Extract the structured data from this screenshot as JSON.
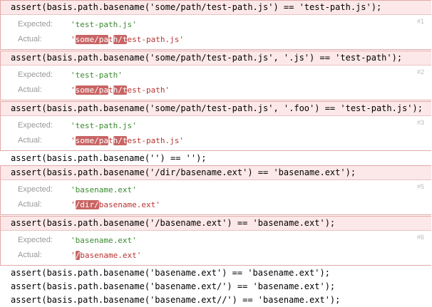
{
  "labels": {
    "expected": "Expected:",
    "actual": "Actual:"
  },
  "items": [
    {
      "code": "assert(basis.path.basename('some/path/test-path.js') == 'test-path.js');",
      "fail": true,
      "num": "#1",
      "expected": "'test-path.js'",
      "actual_parts": [
        {
          "t": "'",
          "h": false
        },
        {
          "t": "some/pa",
          "h": true
        },
        {
          "t": "t",
          "h": false
        },
        {
          "t": "h/t",
          "h": true
        },
        {
          "t": "est-path.js'",
          "h": false
        }
      ]
    },
    {
      "code": "assert(basis.path.basename('some/path/test-path.js', '.js') == 'test-path');",
      "fail": true,
      "num": "#2",
      "expected": "'test-path'",
      "actual_parts": [
        {
          "t": "'",
          "h": false
        },
        {
          "t": "some/pa",
          "h": true
        },
        {
          "t": "t",
          "h": false
        },
        {
          "t": "h/t",
          "h": true
        },
        {
          "t": "est-path'",
          "h": false
        }
      ]
    },
    {
      "code": "assert(basis.path.basename('some/path/test-path.js', '.foo') == 'test-path.js');",
      "fail": true,
      "num": "#3",
      "expected": "'test-path.js'",
      "actual_parts": [
        {
          "t": "'",
          "h": false
        },
        {
          "t": "some/pa",
          "h": true
        },
        {
          "t": "t",
          "h": false
        },
        {
          "t": "h/t",
          "h": true
        },
        {
          "t": "est-path.js'",
          "h": false
        }
      ]
    },
    {
      "code": "assert(basis.path.basename('') == '');",
      "fail": false
    },
    {
      "code": "assert(basis.path.basename('/dir/basename.ext') == 'basename.ext');",
      "fail": true,
      "num": "#5",
      "expected": "'basename.ext'",
      "actual_parts": [
        {
          "t": "'",
          "h": false
        },
        {
          "t": "/dir/",
          "h": true
        },
        {
          "t": "basename.ext'",
          "h": false
        }
      ]
    },
    {
      "code": "assert(basis.path.basename('/basename.ext') == 'basename.ext');",
      "fail": true,
      "num": "#6",
      "expected": "'basename.ext'",
      "actual_parts": [
        {
          "t": "'",
          "h": false
        },
        {
          "t": "/",
          "h": true
        },
        {
          "t": "basename.ext'",
          "h": false
        }
      ]
    },
    {
      "code": "assert(basis.path.basename('basename.ext') == 'basename.ext');",
      "fail": false
    },
    {
      "code": "assert(basis.path.basename('basename.ext/') == 'basename.ext');",
      "fail": false
    },
    {
      "code": "assert(basis.path.basename('basename.ext//') == 'basename.ext');",
      "fail": false
    }
  ]
}
